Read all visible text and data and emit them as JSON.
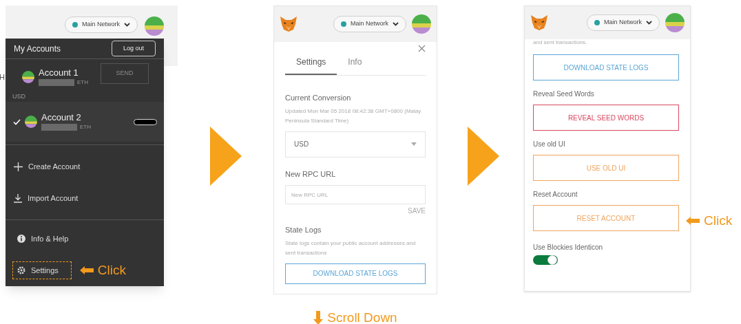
{
  "account_menu": {
    "network": "Main Network",
    "title": "My Accounts",
    "logout": "Log out",
    "behind": {
      "cut_text": "H",
      "currency": "USD",
      "send": "SEND"
    },
    "accounts": [
      {
        "name": "Account 1",
        "unit": "ETH",
        "selected": false,
        "imported": false
      },
      {
        "name": "Account 2",
        "unit": "ETH",
        "selected": true,
        "imported": true
      }
    ],
    "actions": [
      {
        "kind": "plus",
        "label": "Create Account"
      },
      {
        "kind": "download",
        "label": "Import Account"
      }
    ],
    "links": [
      {
        "kind": "info",
        "label": "Info & Help",
        "highlighted": false
      },
      {
        "kind": "gear",
        "label": "Settings",
        "highlighted": true
      }
    ],
    "callout": "Click"
  },
  "settings_top": {
    "network": "Main Network",
    "tabs": [
      {
        "label": "Settings",
        "selected": true
      },
      {
        "label": "Info",
        "selected": false
      }
    ],
    "conversion_label": "Current Conversion",
    "updated": "Updated Mon Mar 05 2018 08:42:38 GMT+0800 (Malay Peninsula Standard Time)",
    "currency": "USD",
    "rpc_label": "New RPC URL",
    "rpc_placeholder": "New RPC URL",
    "save": "SAVE",
    "logs_label": "State Logs",
    "logs_desc": "State logs contain your public account addresses and sent transactions",
    "logs_button": "DOWNLOAD STATE LOGS",
    "callout": "Scroll Down"
  },
  "settings_bottom": {
    "network": "Main Network",
    "cut_text": "and sent transactions.",
    "sections": [
      {
        "kind": "button",
        "button": "DOWNLOAD STATE LOGS",
        "color": "#5aa5d6"
      },
      {
        "kind": "button",
        "label": "Reveal Seed Words",
        "button": "REVEAL SEED WORDS",
        "color": "#d9475f"
      },
      {
        "kind": "button",
        "label": "Use old UI",
        "button": "USE OLD UI",
        "color": "#f0a45c"
      },
      {
        "kind": "button",
        "label": "Reset Account",
        "button": "RESET ACCOUNT",
        "color": "#f0a45c",
        "callout": "Click"
      },
      {
        "kind": "toggle",
        "label": "Use Blockies Identicon",
        "on": true
      }
    ]
  }
}
